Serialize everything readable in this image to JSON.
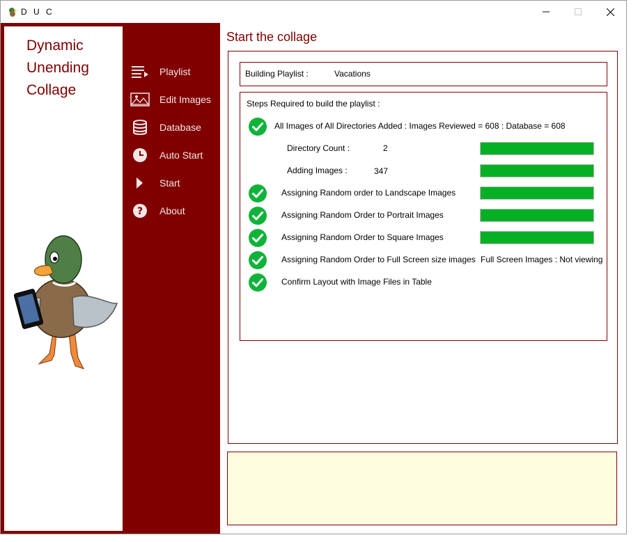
{
  "window": {
    "title": "D U C"
  },
  "brand": {
    "line1": "Dynamic",
    "line2": "Unending",
    "line3": "Collage"
  },
  "nav": {
    "items": [
      {
        "label": "Playlist",
        "icon": "playlist-icon"
      },
      {
        "label": "Edit Images",
        "icon": "image-icon"
      },
      {
        "label": "Database",
        "icon": "database-icon"
      },
      {
        "label": "Auto Start",
        "icon": "clock-icon"
      },
      {
        "label": "Start",
        "icon": "play-icon"
      },
      {
        "label": "About",
        "icon": "help-icon"
      }
    ]
  },
  "main": {
    "title": "Start the collage",
    "playlist_label": "Building Playlist :",
    "playlist_value": "Vacations",
    "steps_header": "Steps Required to build the playlist :",
    "step_all_images": "All Images of All Directories Added : Images Reviewed = 608 : Database = 608",
    "directory_count_label": "Directory Count :",
    "directory_count_value": "2",
    "adding_images_label": "Adding Images :",
    "adding_images_value": "347",
    "step_landscape": "Assigning Random order to Landscape Images",
    "step_portrait": "Assigning Random Order to Portrait Images",
    "step_square": "Assigning Random Order to Square Images",
    "step_fullscreen": "Assigning Random Order to Full Screen size images",
    "fullscreen_status": "Full Screen Images  : Not viewing",
    "step_confirm": "Confirm Layout with Image Files in Table",
    "progress": {
      "directory_count": 1.0,
      "adding_images": 1.0,
      "landscape": 1.0,
      "portrait": 1.0,
      "square": 1.0
    }
  },
  "colors": {
    "accent": "#800000",
    "progress_fill": "#06b025",
    "check": "#0fb33a",
    "message_bg": "#fffde0"
  }
}
